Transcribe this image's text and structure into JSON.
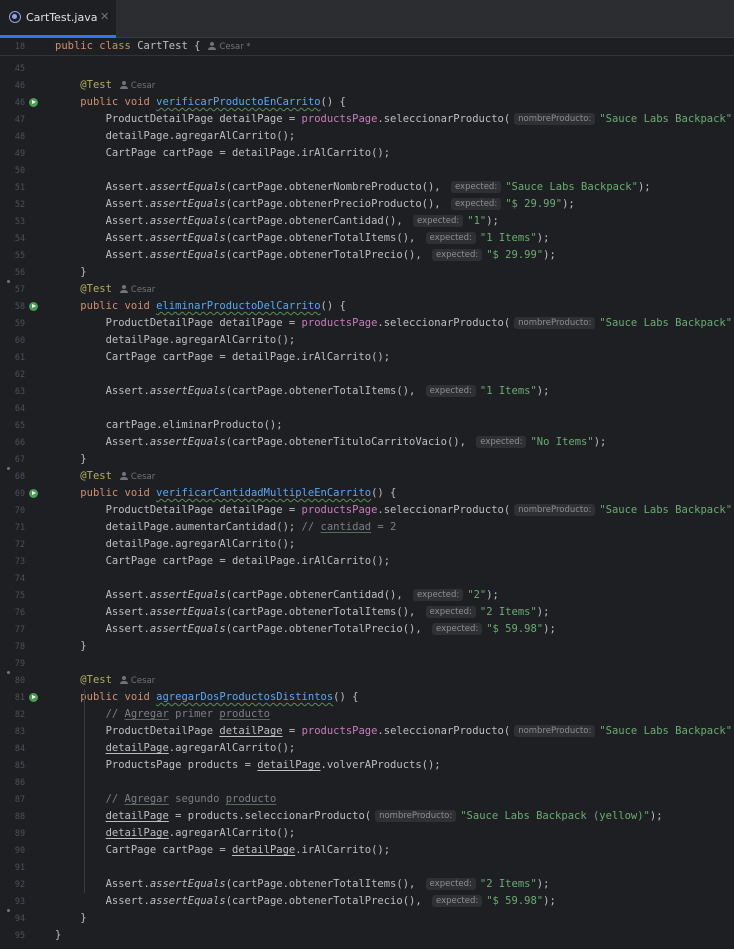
{
  "tab": {
    "label": "CartTest.java",
    "close": "✕"
  },
  "sticky": {
    "line_number": "18",
    "text": "public class CartTest {",
    "author": "Cesar *"
  },
  "author": "Cesar",
  "lines": [
    {
      "n": "45",
      "segs": []
    },
    {
      "n": "46",
      "segs": [
        {
          "t": "    "
        },
        {
          "t": "@Test",
          "c": "ann"
        }
      ],
      "author": true
    },
    {
      "n": "46",
      "run": true,
      "segs": [
        {
          "t": "    "
        },
        {
          "t": "public void ",
          "c": "kw"
        },
        {
          "t": "verificarProductoEnCarrito",
          "c": "mth sq"
        },
        {
          "t": "() {"
        }
      ]
    },
    {
      "n": "47",
      "segs": [
        {
          "t": "        ProductDetailPage detailPage = "
        },
        {
          "t": "productsPage",
          "c": "fld"
        },
        {
          "t": ".seleccionarProducto("
        },
        {
          "hint": "nombreProducto:"
        },
        {
          "t": "\"Sauce Labs Backpack\"",
          "c": "str"
        },
        {
          "t": ");"
        }
      ]
    },
    {
      "n": "48",
      "segs": [
        {
          "t": "        detailPage.agregarAlCarrito();"
        }
      ]
    },
    {
      "n": "49",
      "segs": [
        {
          "t": "        CartPage cartPage = detailPage.irAlCarrito();"
        }
      ]
    },
    {
      "n": "50",
      "segs": []
    },
    {
      "n": "51",
      "segs": [
        {
          "t": "        Assert."
        },
        {
          "t": "assertEquals",
          "c": "static"
        },
        {
          "t": "(cartPage.obtenerNombreProducto(), "
        },
        {
          "hint": "expected:"
        },
        {
          "t": "\"Sauce Labs Backpack\"",
          "c": "str"
        },
        {
          "t": ");"
        }
      ]
    },
    {
      "n": "52",
      "segs": [
        {
          "t": "        Assert."
        },
        {
          "t": "assertEquals",
          "c": "static"
        },
        {
          "t": "(cartPage.obtenerPrecioProducto(), "
        },
        {
          "hint": "expected:"
        },
        {
          "t": "\"$ 29.99\"",
          "c": "str"
        },
        {
          "t": ");"
        }
      ]
    },
    {
      "n": "53",
      "segs": [
        {
          "t": "        Assert."
        },
        {
          "t": "assertEquals",
          "c": "static"
        },
        {
          "t": "(cartPage.obtenerCantidad(), "
        },
        {
          "hint": "expected:"
        },
        {
          "t": "\"1\"",
          "c": "str"
        },
        {
          "t": ");"
        }
      ]
    },
    {
      "n": "54",
      "segs": [
        {
          "t": "        Assert."
        },
        {
          "t": "assertEquals",
          "c": "static"
        },
        {
          "t": "(cartPage.obtenerTotalItems(), "
        },
        {
          "hint": "expected:"
        },
        {
          "t": "\"1 Items\"",
          "c": "str"
        },
        {
          "t": ");"
        }
      ]
    },
    {
      "n": "55",
      "segs": [
        {
          "t": "        Assert."
        },
        {
          "t": "assertEquals",
          "c": "static"
        },
        {
          "t": "(cartPage.obtenerTotalPrecio(), "
        },
        {
          "hint": "expected:"
        },
        {
          "t": "\"$ 29.99\"",
          "c": "str"
        },
        {
          "t": ");"
        }
      ]
    },
    {
      "n": "56",
      "segs": [
        {
          "t": "    }"
        }
      ]
    },
    {
      "n": "57",
      "segs": [
        {
          "t": "    "
        },
        {
          "t": "@Test",
          "c": "ann"
        }
      ],
      "author": true
    },
    {
      "n": "58",
      "run": true,
      "segs": [
        {
          "t": "    "
        },
        {
          "t": "public void ",
          "c": "kw"
        },
        {
          "t": "eliminarProductoDelCarrito",
          "c": "mth sq"
        },
        {
          "t": "() {"
        }
      ]
    },
    {
      "n": "59",
      "segs": [
        {
          "t": "        ProductDetailPage detailPage = "
        },
        {
          "t": "productsPage",
          "c": "fld"
        },
        {
          "t": ".seleccionarProducto("
        },
        {
          "hint": "nombreProducto:"
        },
        {
          "t": "\"Sauce Labs Backpack\"",
          "c": "str"
        },
        {
          "t": ");"
        }
      ]
    },
    {
      "n": "60",
      "segs": [
        {
          "t": "        detailPage.agregarAlCarrito();"
        }
      ]
    },
    {
      "n": "61",
      "segs": [
        {
          "t": "        CartPage cartPage = detailPage.irAlCarrito();"
        }
      ]
    },
    {
      "n": "62",
      "segs": []
    },
    {
      "n": "63",
      "segs": [
        {
          "t": "        Assert."
        },
        {
          "t": "assertEquals",
          "c": "static"
        },
        {
          "t": "(cartPage.obtenerTotalItems(), "
        },
        {
          "hint": "expected:"
        },
        {
          "t": "\"1 Items\"",
          "c": "str"
        },
        {
          "t": ");"
        }
      ]
    },
    {
      "n": "64",
      "segs": []
    },
    {
      "n": "65",
      "segs": [
        {
          "t": "        cartPage.eliminarProducto();"
        }
      ]
    },
    {
      "n": "66",
      "segs": [
        {
          "t": "        Assert."
        },
        {
          "t": "assertEquals",
          "c": "static"
        },
        {
          "t": "(cartPage.obtenerTituloCarritoVacio(), "
        },
        {
          "hint": "expected:"
        },
        {
          "t": "\"No Items\"",
          "c": "str"
        },
        {
          "t": ");"
        }
      ]
    },
    {
      "n": "67",
      "segs": [
        {
          "t": "    }"
        }
      ]
    },
    {
      "n": "68",
      "segs": [
        {
          "t": "    "
        },
        {
          "t": "@Test",
          "c": "ann"
        }
      ],
      "author": true
    },
    {
      "n": "69",
      "run": true,
      "segs": [
        {
          "t": "    "
        },
        {
          "t": "public void ",
          "c": "kw"
        },
        {
          "t": "verificarCantidadMultipleEnCarrito",
          "c": "mth sq"
        },
        {
          "t": "() {"
        }
      ]
    },
    {
      "n": "70",
      "segs": [
        {
          "t": "        ProductDetailPage detailPage = "
        },
        {
          "t": "productsPage",
          "c": "fld"
        },
        {
          "t": ".seleccionarProducto("
        },
        {
          "hint": "nombreProducto:"
        },
        {
          "t": "\"Sauce Labs Backpack\"",
          "c": "str"
        },
        {
          "t": ");"
        }
      ]
    },
    {
      "n": "71",
      "segs": [
        {
          "t": "        detailPage.aumentarCantidad(); "
        },
        {
          "t": "// ",
          "c": "cmt"
        },
        {
          "t": "cantidad",
          "c": "cmt cmt-ul"
        },
        {
          "t": " = 2",
          "c": "cmt"
        }
      ]
    },
    {
      "n": "72",
      "segs": [
        {
          "t": "        detailPage.agregarAlCarrito();"
        }
      ]
    },
    {
      "n": "73",
      "segs": [
        {
          "t": "        CartPage cartPage = detailPage.irAlCarrito();"
        }
      ]
    },
    {
      "n": "74",
      "segs": []
    },
    {
      "n": "75",
      "segs": [
        {
          "t": "        Assert."
        },
        {
          "t": "assertEquals",
          "c": "static"
        },
        {
          "t": "(cartPage.obtenerCantidad(), "
        },
        {
          "hint": "expected:"
        },
        {
          "t": "\"2\"",
          "c": "str"
        },
        {
          "t": ");"
        }
      ]
    },
    {
      "n": "76",
      "segs": [
        {
          "t": "        Assert."
        },
        {
          "t": "assertEquals",
          "c": "static"
        },
        {
          "t": "(cartPage.obtenerTotalItems(), "
        },
        {
          "hint": "expected:"
        },
        {
          "t": "\"2 Items\"",
          "c": "str"
        },
        {
          "t": ");"
        }
      ]
    },
    {
      "n": "77",
      "segs": [
        {
          "t": "        Assert."
        },
        {
          "t": "assertEquals",
          "c": "static"
        },
        {
          "t": "(cartPage.obtenerTotalPrecio(), "
        },
        {
          "hint": "expected:"
        },
        {
          "t": "\"$ 59.98\"",
          "c": "str"
        },
        {
          "t": ");"
        }
      ]
    },
    {
      "n": "78",
      "segs": [
        {
          "t": "    }"
        }
      ]
    },
    {
      "n": "79",
      "segs": []
    },
    {
      "n": "80",
      "segs": [
        {
          "t": "    "
        },
        {
          "t": "@Test",
          "c": "ann"
        }
      ],
      "author": true
    },
    {
      "n": "81",
      "run": true,
      "segs": [
        {
          "t": "    "
        },
        {
          "t": "public void ",
          "c": "kw"
        },
        {
          "t": "agregarDosProductosDistintos",
          "c": "mth sq"
        },
        {
          "t": "() {"
        }
      ]
    },
    {
      "n": "82",
      "segs": [
        {
          "t": "        "
        },
        {
          "t": "// ",
          "c": "cmt"
        },
        {
          "t": "Agregar",
          "c": "cmt cmt-ul"
        },
        {
          "t": " primer ",
          "c": "cmt"
        },
        {
          "t": "producto",
          "c": "cmt cmt-ul"
        }
      ]
    },
    {
      "n": "83",
      "segs": [
        {
          "t": "        ProductDetailPage "
        },
        {
          "t": "detailPage",
          "c": "ul"
        },
        {
          "t": " = "
        },
        {
          "t": "productsPage",
          "c": "fld"
        },
        {
          "t": ".seleccionarProducto("
        },
        {
          "hint": "nombreProducto:"
        },
        {
          "t": "\"Sauce Labs Backpack\"",
          "c": "str"
        },
        {
          "t": ");"
        }
      ]
    },
    {
      "n": "84",
      "segs": [
        {
          "t": "        "
        },
        {
          "t": "detailPage",
          "c": "ul"
        },
        {
          "t": ".agregarAlCarrito();"
        }
      ]
    },
    {
      "n": "85",
      "segs": [
        {
          "t": "        ProductsPage products = "
        },
        {
          "t": "detailPage",
          "c": "ul"
        },
        {
          "t": ".volverAProducts();"
        }
      ]
    },
    {
      "n": "86",
      "segs": []
    },
    {
      "n": "87",
      "segs": [
        {
          "t": "        "
        },
        {
          "t": "// ",
          "c": "cmt"
        },
        {
          "t": "Agregar",
          "c": "cmt cmt-ul"
        },
        {
          "t": " segundo ",
          "c": "cmt"
        },
        {
          "t": "producto",
          "c": "cmt cmt-ul"
        }
      ]
    },
    {
      "n": "88",
      "segs": [
        {
          "t": "        "
        },
        {
          "t": "detailPage",
          "c": "ul"
        },
        {
          "t": " = products.seleccionarProducto("
        },
        {
          "hint": "nombreProducto:"
        },
        {
          "t": "\"Sauce Labs Backpack (yellow)\"",
          "c": "str"
        },
        {
          "t": ");"
        }
      ]
    },
    {
      "n": "89",
      "segs": [
        {
          "t": "        "
        },
        {
          "t": "detailPage",
          "c": "ul"
        },
        {
          "t": ".agregarAlCarrito();"
        }
      ]
    },
    {
      "n": "90",
      "segs": [
        {
          "t": "        CartPage cartPage = "
        },
        {
          "t": "detailPage",
          "c": "ul"
        },
        {
          "t": ".irAlCarrito();"
        }
      ]
    },
    {
      "n": "91",
      "segs": []
    },
    {
      "n": "92",
      "segs": [
        {
          "t": "        Assert."
        },
        {
          "t": "assertEquals",
          "c": "static"
        },
        {
          "t": "(cartPage.obtenerTotalItems(), "
        },
        {
          "hint": "expected:"
        },
        {
          "t": "\"2 Items\"",
          "c": "str"
        },
        {
          "t": ");"
        }
      ]
    },
    {
      "n": "93",
      "segs": [
        {
          "t": "        Assert."
        },
        {
          "t": "assertEquals",
          "c": "static"
        },
        {
          "t": "(cartPage.obtenerTotalPrecio(), "
        },
        {
          "hint": "expected:"
        },
        {
          "t": "\"$ 59.98\"",
          "c": "str"
        },
        {
          "t": ");"
        }
      ]
    },
    {
      "n": "94",
      "segs": [
        {
          "t": "    }"
        }
      ]
    },
    {
      "n": "95",
      "segs": [
        {
          "t": "}"
        }
      ]
    }
  ]
}
